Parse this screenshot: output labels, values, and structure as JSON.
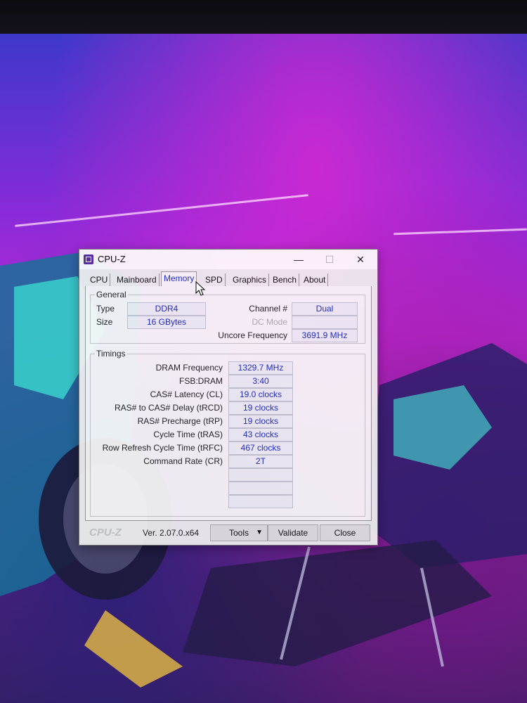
{
  "window": {
    "title": "CPU-Z",
    "minimize_glyph": "—",
    "maximize_glyph": "☐",
    "close_glyph": "✕"
  },
  "tabs": [
    {
      "label": "CPU"
    },
    {
      "label": "Mainboard"
    },
    {
      "label": "Memory",
      "active": true
    },
    {
      "label": "SPD"
    },
    {
      "label": "Graphics"
    },
    {
      "label": "Bench"
    },
    {
      "label": "About"
    }
  ],
  "general": {
    "group_label": "General",
    "type_label": "Type",
    "type_value": "DDR4",
    "size_label": "Size",
    "size_value": "16 GBytes",
    "channel_label": "Channel #",
    "channel_value": "Dual",
    "dc_mode_label": "DC Mode",
    "uncore_label": "Uncore Frequency",
    "uncore_value": "3691.9 MHz"
  },
  "timings": {
    "group_label": "Timings",
    "rows": [
      {
        "label": "DRAM Frequency",
        "value": "1329.7 MHz"
      },
      {
        "label": "FSB:DRAM",
        "value": "3:40"
      },
      {
        "label": "CAS# Latency (CL)",
        "value": "19.0 clocks"
      },
      {
        "label": "RAS# to CAS# Delay (tRCD)",
        "value": "19 clocks"
      },
      {
        "label": "RAS# Precharge (tRP)",
        "value": "19 clocks"
      },
      {
        "label": "Cycle Time (tRAS)",
        "value": "43 clocks"
      },
      {
        "label": "Row Refresh Cycle Time (tRFC)",
        "value": "467 clocks"
      },
      {
        "label": "Command Rate (CR)",
        "value": "2T"
      }
    ]
  },
  "footer": {
    "brand": "CPU-Z",
    "version": "Ver. 2.07.0.x64",
    "tools_label": "Tools",
    "tools_arrow": "▼",
    "validate_label": "Validate",
    "close_label": "Close"
  },
  "colors": {
    "value_text": "#1a2fc2",
    "wallpaper_magenta": "#c02ad6",
    "wallpaper_blue": "#3d38c9"
  }
}
